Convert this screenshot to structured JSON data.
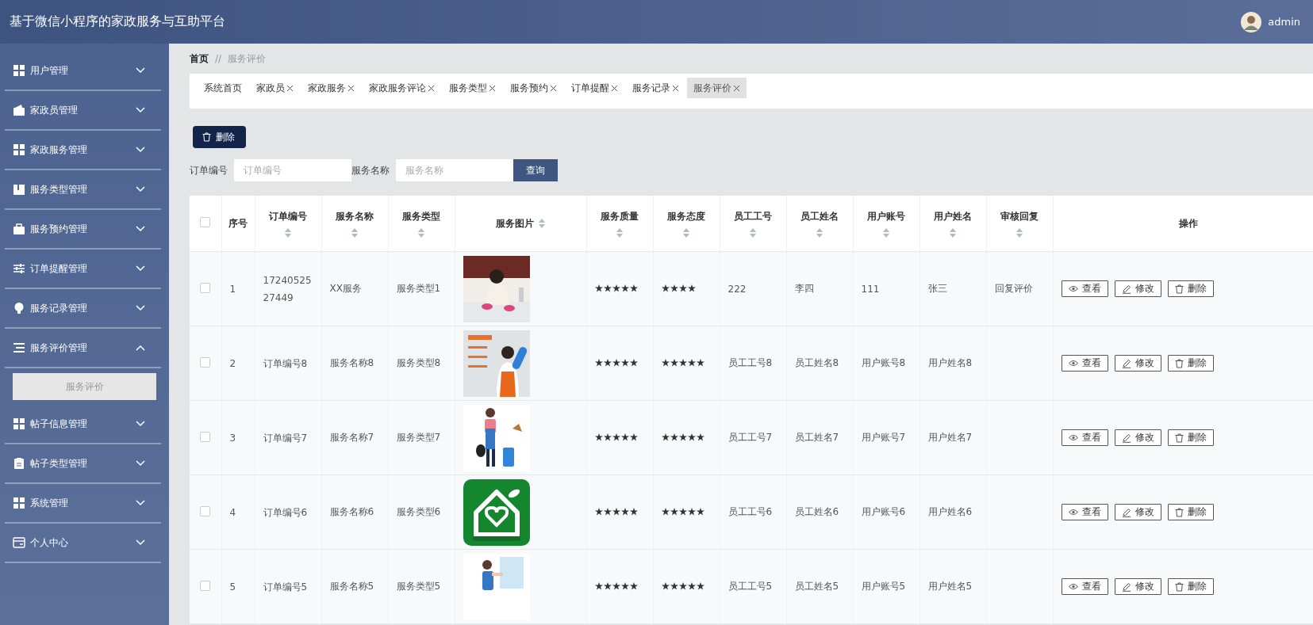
{
  "header": {
    "title": "基于微信小程序的家政服务与互助平台",
    "username": "admin"
  },
  "sidebar": {
    "items": [
      {
        "label": "用户管理",
        "kind": "grid",
        "expanded": false
      },
      {
        "label": "家政员管理",
        "kind": "wallet",
        "expanded": false
      },
      {
        "label": "家政服务管理",
        "kind": "grid",
        "expanded": false
      },
      {
        "label": "服务类型管理",
        "kind": "book",
        "expanded": false
      },
      {
        "label": "服务预约管理",
        "kind": "briefcase",
        "expanded": false
      },
      {
        "label": "订单提醒管理",
        "kind": "sliders",
        "expanded": false
      },
      {
        "label": "服务记录管理",
        "kind": "bulb",
        "expanded": false
      },
      {
        "label": "服务评价管理",
        "kind": "list",
        "expanded": true,
        "children": [
          {
            "label": "服务评价",
            "selected": true
          }
        ]
      },
      {
        "label": "帖子信息管理",
        "kind": "grid",
        "expanded": false
      },
      {
        "label": "帖子类型管理",
        "kind": "clipboard",
        "expanded": false
      },
      {
        "label": "系统管理",
        "kind": "grid",
        "expanded": false
      },
      {
        "label": "个人中心",
        "kind": "card",
        "expanded": false
      }
    ]
  },
  "breadcrumb": {
    "home": "首页",
    "separator": "//",
    "current": "服务评价"
  },
  "tabs": [
    {
      "label": "系统首页",
      "closable": false,
      "selected": false
    },
    {
      "label": "家政员",
      "closable": true,
      "selected": false
    },
    {
      "label": "家政服务",
      "closable": true,
      "selected": false
    },
    {
      "label": "家政服务评论",
      "closable": true,
      "selected": false
    },
    {
      "label": "服务类型",
      "closable": true,
      "selected": false
    },
    {
      "label": "服务预约",
      "closable": true,
      "selected": false
    },
    {
      "label": "订单提醒",
      "closable": true,
      "selected": false
    },
    {
      "label": "服务记录",
      "closable": true,
      "selected": false
    },
    {
      "label": "服务评价",
      "closable": true,
      "selected": true
    }
  ],
  "toolbar": {
    "delete_button": "删除"
  },
  "search": {
    "fields": [
      {
        "label": "订单编号",
        "placeholder": "订单编号"
      },
      {
        "label": "服务名称",
        "placeholder": "服务名称"
      }
    ],
    "button": "查询"
  },
  "table": {
    "select_all_checked": false,
    "columns": [
      {
        "label": "序号",
        "sortable": false
      },
      {
        "label": "订单编号",
        "sortable": true
      },
      {
        "label": "服务名称",
        "sortable": true
      },
      {
        "label": "服务类型",
        "sortable": true
      },
      {
        "label": "服务图片",
        "sortable": true
      },
      {
        "label": "服务质量",
        "sortable": true
      },
      {
        "label": "服务态度",
        "sortable": true
      },
      {
        "label": "员工工号",
        "sortable": true
      },
      {
        "label": "员工姓名",
        "sortable": true
      },
      {
        "label": "用户账号",
        "sortable": true
      },
      {
        "label": "用户姓名",
        "sortable": true
      },
      {
        "label": "审核回复",
        "sortable": true
      },
      {
        "label": "操作",
        "sortable": false
      }
    ],
    "rows": [
      {
        "checked": false,
        "index": "1",
        "order_no": "1724052527449",
        "service_name": "XX服务",
        "service_type": "服务类型1",
        "quality": {
          "stars": 5
        },
        "attitude": {
          "stars": 4
        },
        "staff_no": "222",
        "staff_name": "李四",
        "user_account": "111",
        "user_name": "张三",
        "reply": "回复评价",
        "actions": [
          {
            "kind": "view",
            "label": "查看"
          },
          {
            "kind": "edit",
            "label": "修改"
          },
          {
            "kind": "delete",
            "label": "删除"
          }
        ]
      },
      {
        "checked": false,
        "index": "2",
        "order_no": "订单编号8",
        "service_name": "服务名称8",
        "service_type": "服务类型8",
        "quality": {
          "stars": 5
        },
        "attitude": {
          "stars": 5
        },
        "staff_no": "员工工号8",
        "staff_name": "员工姓名8",
        "user_account": "用户账号8",
        "user_name": "用户姓名8",
        "actions": [
          {
            "kind": "view",
            "label": "查看"
          },
          {
            "kind": "edit",
            "label": "修改"
          },
          {
            "kind": "delete",
            "label": "删除"
          }
        ]
      },
      {
        "checked": false,
        "index": "3",
        "order_no": "订单编号7",
        "service_name": "服务名称7",
        "service_type": "服务类型7",
        "quality": {
          "stars": 5
        },
        "attitude": {
          "stars": 5
        },
        "staff_no": "员工工号7",
        "staff_name": "员工姓名7",
        "user_account": "用户账号7",
        "user_name": "用户姓名7",
        "actions": [
          {
            "kind": "view",
            "label": "查看"
          },
          {
            "kind": "edit",
            "label": "修改"
          },
          {
            "kind": "delete",
            "label": "删除"
          }
        ]
      },
      {
        "checked": false,
        "index": "4",
        "order_no": "订单编号6",
        "service_name": "服务名称6",
        "service_type": "服务类型6",
        "quality": {
          "stars": 5
        },
        "attitude": {
          "stars": 5
        },
        "staff_no": "员工工号6",
        "staff_name": "员工姓名6",
        "user_account": "用户账号6",
        "user_name": "用户姓名6",
        "actions": [
          {
            "kind": "view",
            "label": "查看"
          },
          {
            "kind": "edit",
            "label": "修改"
          },
          {
            "kind": "delete",
            "label": "删除"
          }
        ]
      },
      {
        "checked": false,
        "index": "5",
        "order_no": "订单编号5",
        "service_name": "服务名称5",
        "service_type": "服务类型5",
        "quality": {
          "stars": 5
        },
        "attitude": {
          "stars": 5
        },
        "staff_no": "员工工号5",
        "staff_name": "员工姓名5",
        "user_account": "用户账号5",
        "user_name": "用户姓名5",
        "actions": [
          {
            "kind": "view",
            "label": "查看"
          },
          {
            "kind": "edit",
            "label": "修改"
          },
          {
            "kind": "delete",
            "label": "删除"
          }
        ]
      }
    ]
  }
}
